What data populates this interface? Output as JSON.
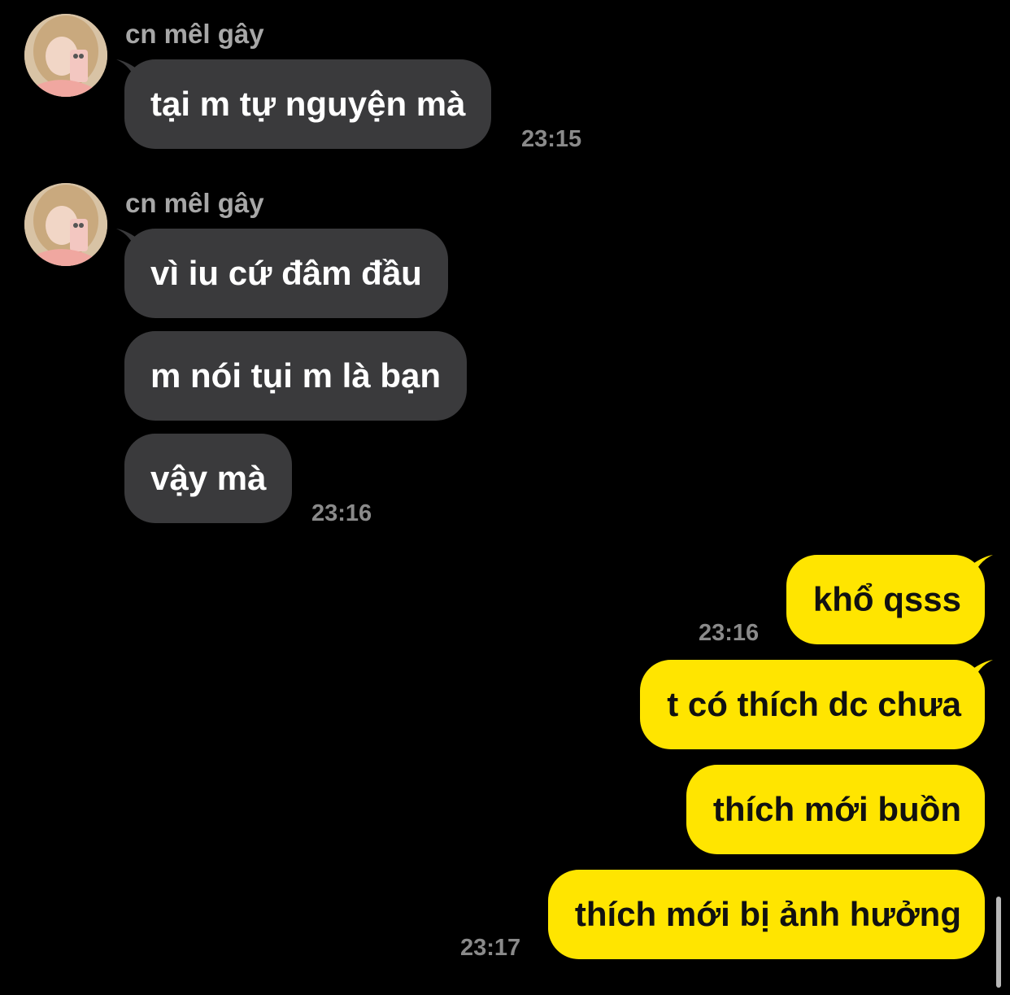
{
  "conversation": {
    "sender_name": "cn mêl gây",
    "groups": [
      {
        "messages": [
          "tại m tự nguyện mà"
        ],
        "time": "23:15"
      },
      {
        "messages": [
          "vì iu cứ đâm đầu",
          "m nói tụi m là bạn",
          "vậy mà"
        ],
        "time": "23:16"
      }
    ],
    "outgoing": [
      {
        "messages": [
          "khổ qsss"
        ],
        "time": "23:16"
      },
      {
        "messages": [
          "t có thích dc chưa",
          "thích mới buồn",
          "thích mới bị ảnh hưởng"
        ],
        "time": "23:17"
      }
    ]
  },
  "colors": {
    "background": "#000000",
    "incoming_bubble": "#3a3a3c",
    "outgoing_bubble": "#ffe500",
    "timestamp": "#8a8a8a"
  }
}
